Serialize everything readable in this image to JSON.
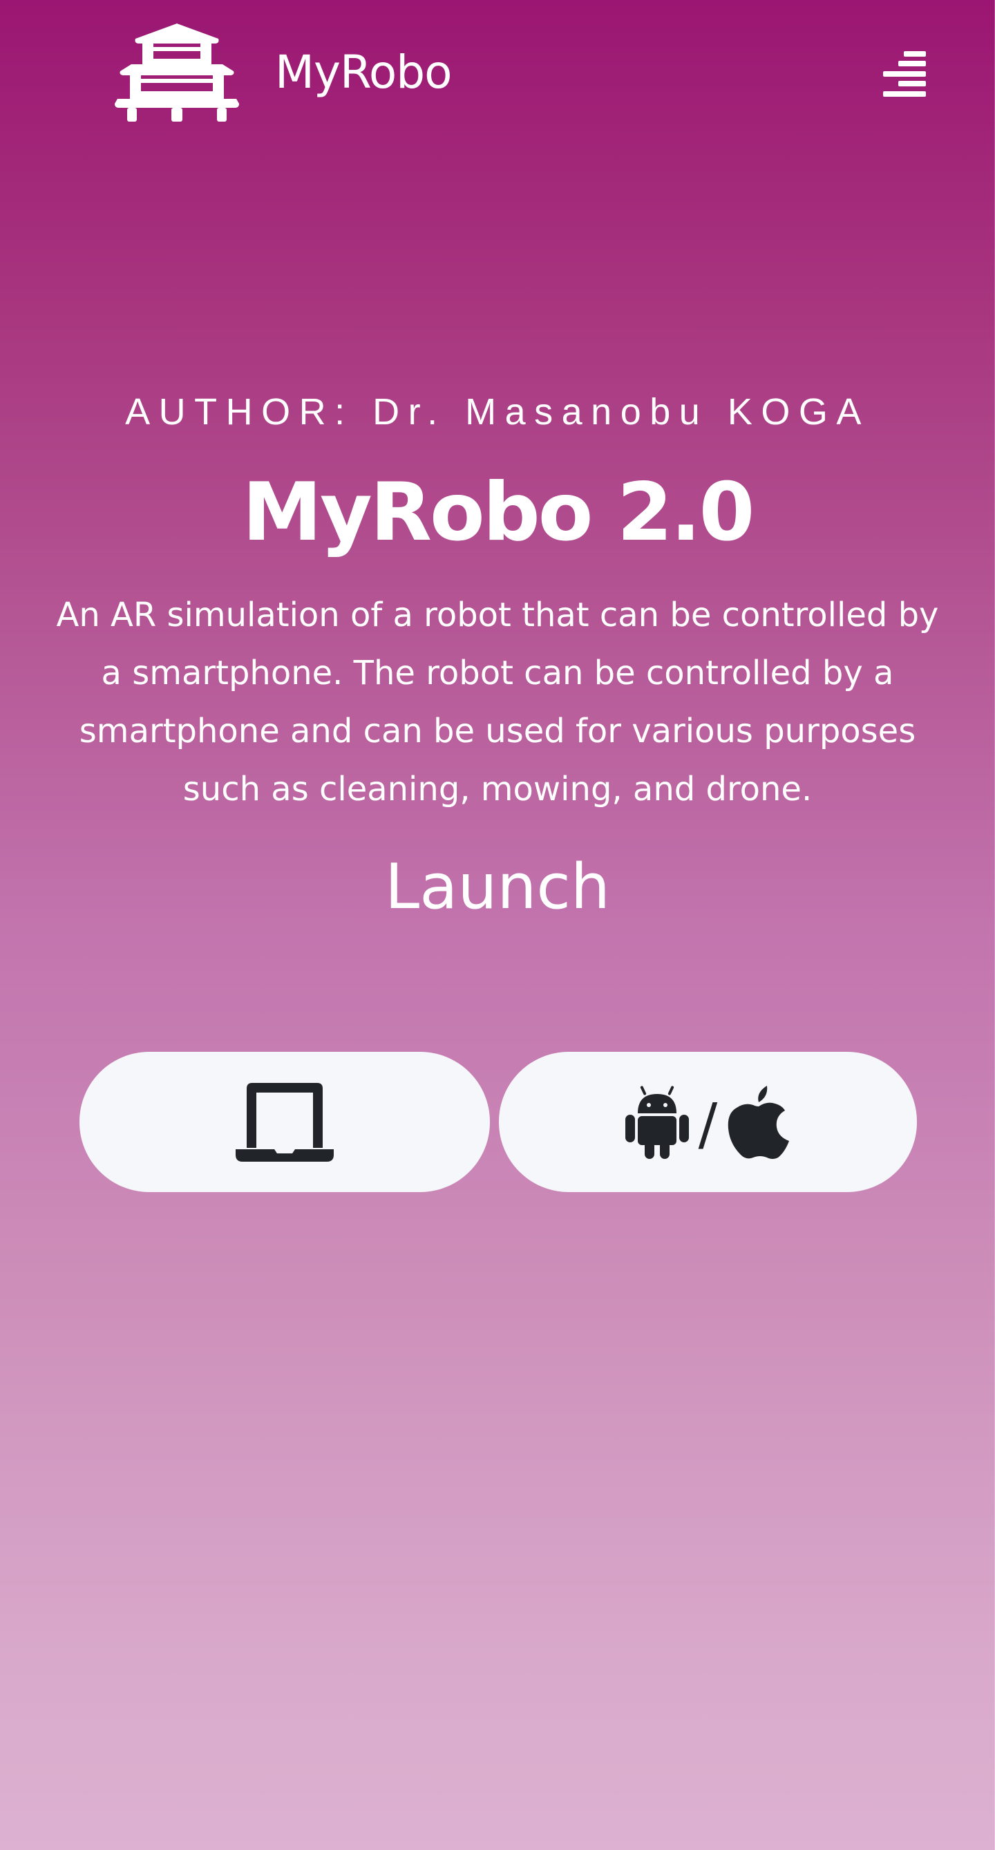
{
  "header": {
    "brand_name": "MyRobo",
    "logo_icon": "pagoda-icon",
    "menu_icon": "menu-icon"
  },
  "hero": {
    "author": "AUTHOR: Dr. Masanobu KOGA",
    "title": "MyRobo 2.0",
    "description": "An AR simulation of a robot that can be controlled by a smartphone. The robot can be controlled by a smartphone and can be used for various purposes such as cleaning, mowing, and drone.",
    "launch_heading": "Launch",
    "launch_buttons": [
      {
        "icon": "laptop-icon"
      },
      {
        "icons": [
          "android-icon",
          "apple-icon"
        ],
        "separator": "/"
      }
    ]
  },
  "colors": {
    "gradient_top": "#9b1672",
    "gradient_bottom": "#dcb1d1",
    "button_bg": "#f6f7fa",
    "icon_dark": "#212529"
  }
}
